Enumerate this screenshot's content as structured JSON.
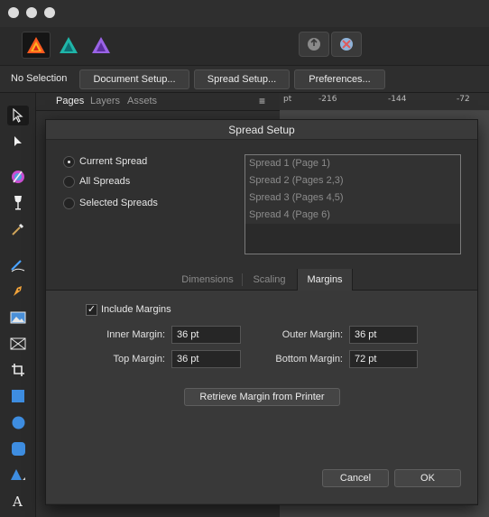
{
  "persona_bar": {
    "personas": [
      {
        "name": "publisher-persona-icon",
        "color": "#ff5a1f"
      },
      {
        "name": "designer-persona-icon",
        "color": "#1fb5a8"
      },
      {
        "name": "photo-persona-icon",
        "color": "#b37dff"
      }
    ]
  },
  "context_toolbar": {
    "selection_status": "No Selection",
    "document_setup_label": "Document Setup...",
    "spread_setup_label": "Spread Setup...",
    "preferences_label": "Preferences..."
  },
  "panel": {
    "tabs": [
      "Pages",
      "Layers",
      "Assets"
    ]
  },
  "ruler": {
    "unit": "pt",
    "ticks": [
      "-216",
      "-144",
      "-72"
    ]
  },
  "dialog": {
    "title": "Spread Setup",
    "scope_options": [
      {
        "label": "Current Spread",
        "selected": true
      },
      {
        "label": "All Spreads",
        "selected": false
      },
      {
        "label": "Selected Spreads",
        "selected": false
      }
    ],
    "spreads": [
      "Spread 1 (Page 1)",
      "Spread 2 (Pages 2,3)",
      "Spread 3 (Pages 4,5)",
      "Spread 4 (Page 6)"
    ],
    "tabs": [
      {
        "label": "Dimensions",
        "active": false
      },
      {
        "label": "Scaling",
        "active": false
      },
      {
        "label": "Margins",
        "active": true
      }
    ],
    "margins": {
      "include_margins_label": "Include Margins",
      "include_margins_checked": true,
      "checkmark": "✓",
      "inner_margin_label": "Inner Margin:",
      "inner_margin_value": "36 pt",
      "outer_margin_label": "Outer Margin:",
      "outer_margin_value": "36 pt",
      "top_margin_label": "Top Margin:",
      "top_margin_value": "36 pt",
      "bottom_margin_label": "Bottom Margin:",
      "bottom_margin_value": "72 pt",
      "retrieve_button_label": "Retrieve Margin from Printer"
    },
    "cancel_label": "Cancel",
    "ok_label": "OK"
  }
}
